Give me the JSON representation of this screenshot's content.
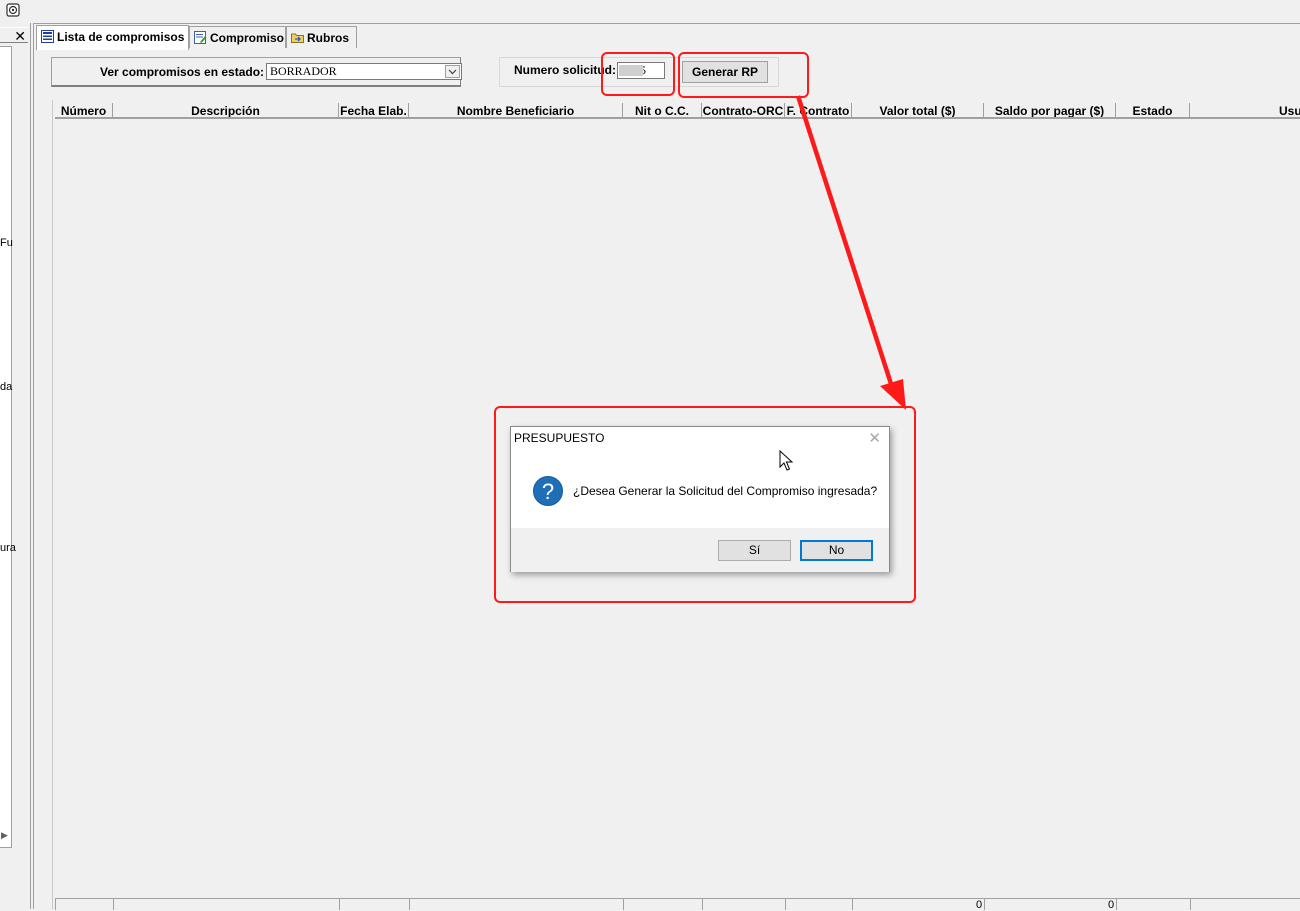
{
  "left_panel": {
    "close_label": "✕",
    "fragments": [
      "Fu",
      "da",
      "ura"
    ]
  },
  "tabs": [
    {
      "label": "Lista de compromisos",
      "icon": "list-icon",
      "active": true
    },
    {
      "label": "Compromiso",
      "icon": "document-edit-icon",
      "active": false
    },
    {
      "label": "Rubros",
      "icon": "folder-arrow-icon",
      "active": false
    }
  ],
  "filter": {
    "label": "Ver compromisos en estado:",
    "value": "BORRADOR"
  },
  "solicitud": {
    "label": "Numero solicitud:",
    "value": "5"
  },
  "toolbar": {
    "generate_label": "Generar RP"
  },
  "grid": {
    "columns": [
      "Número",
      "Descripción",
      "Fecha Elab.",
      "Nombre Beneficiario",
      "Nit o C.C.",
      "Contrato-ORC",
      "F. Contrato",
      "Valor total ($)",
      "Saldo por pagar ($)",
      "Estado",
      "Usuario"
    ],
    "totals": {
      "valor_total": "0",
      "saldo_por_pagar": "0"
    }
  },
  "dialog": {
    "title": "PRESUPUESTO",
    "close_label": "✕",
    "icon": "question-icon",
    "message": "¿Desea Generar la Solicitud del Compromiso ingresada?",
    "yes_label": "Sí",
    "no_label": "No"
  },
  "colors": {
    "annotation": "#ff1a1a",
    "focus": "#0078d7",
    "question_icon": "#1f6fb8"
  }
}
